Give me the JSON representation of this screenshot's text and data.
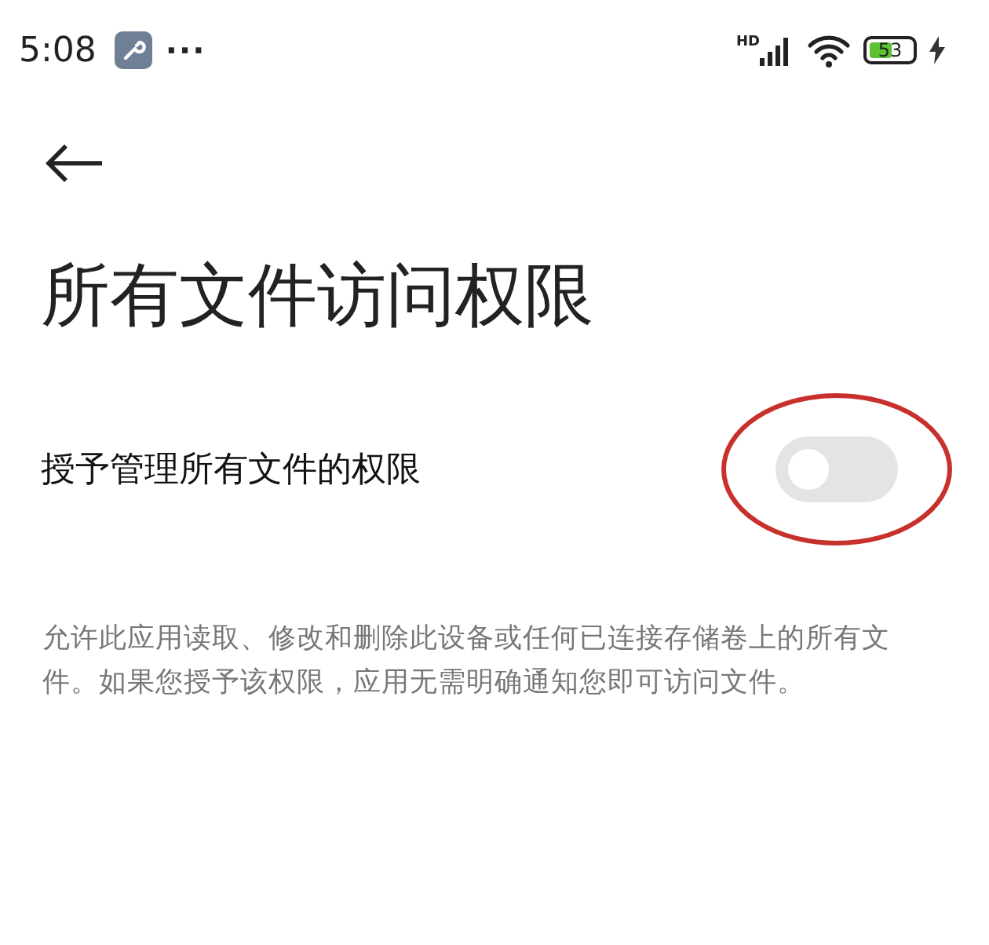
{
  "status_bar": {
    "time": "5:08",
    "more": "···",
    "network": "HD",
    "battery": "53"
  },
  "title": "所有文件访问权限",
  "setting": {
    "label": "授予管理所有文件的权限",
    "on": false,
    "circled": true
  },
  "description": "允许此应用读取、修改和删除此设备或任何已连接存储卷上的所有文件。如果您授予该权限，应用无需明确通知您即可访问文件。"
}
